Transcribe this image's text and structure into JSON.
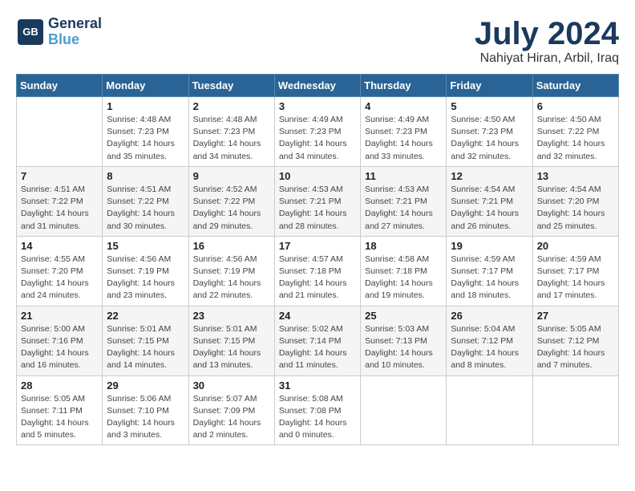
{
  "header": {
    "logo_line1": "General",
    "logo_line2": "Blue",
    "month_title": "July 2024",
    "location": "Nahiyat Hiran, Arbil, Iraq"
  },
  "days_of_week": [
    "Sunday",
    "Monday",
    "Tuesday",
    "Wednesday",
    "Thursday",
    "Friday",
    "Saturday"
  ],
  "weeks": [
    [
      {
        "num": "",
        "info": ""
      },
      {
        "num": "1",
        "info": "Sunrise: 4:48 AM\nSunset: 7:23 PM\nDaylight: 14 hours\nand 35 minutes."
      },
      {
        "num": "2",
        "info": "Sunrise: 4:48 AM\nSunset: 7:23 PM\nDaylight: 14 hours\nand 34 minutes."
      },
      {
        "num": "3",
        "info": "Sunrise: 4:49 AM\nSunset: 7:23 PM\nDaylight: 14 hours\nand 34 minutes."
      },
      {
        "num": "4",
        "info": "Sunrise: 4:49 AM\nSunset: 7:23 PM\nDaylight: 14 hours\nand 33 minutes."
      },
      {
        "num": "5",
        "info": "Sunrise: 4:50 AM\nSunset: 7:23 PM\nDaylight: 14 hours\nand 32 minutes."
      },
      {
        "num": "6",
        "info": "Sunrise: 4:50 AM\nSunset: 7:22 PM\nDaylight: 14 hours\nand 32 minutes."
      }
    ],
    [
      {
        "num": "7",
        "info": "Sunrise: 4:51 AM\nSunset: 7:22 PM\nDaylight: 14 hours\nand 31 minutes."
      },
      {
        "num": "8",
        "info": "Sunrise: 4:51 AM\nSunset: 7:22 PM\nDaylight: 14 hours\nand 30 minutes."
      },
      {
        "num": "9",
        "info": "Sunrise: 4:52 AM\nSunset: 7:22 PM\nDaylight: 14 hours\nand 29 minutes."
      },
      {
        "num": "10",
        "info": "Sunrise: 4:53 AM\nSunset: 7:21 PM\nDaylight: 14 hours\nand 28 minutes."
      },
      {
        "num": "11",
        "info": "Sunrise: 4:53 AM\nSunset: 7:21 PM\nDaylight: 14 hours\nand 27 minutes."
      },
      {
        "num": "12",
        "info": "Sunrise: 4:54 AM\nSunset: 7:21 PM\nDaylight: 14 hours\nand 26 minutes."
      },
      {
        "num": "13",
        "info": "Sunrise: 4:54 AM\nSunset: 7:20 PM\nDaylight: 14 hours\nand 25 minutes."
      }
    ],
    [
      {
        "num": "14",
        "info": "Sunrise: 4:55 AM\nSunset: 7:20 PM\nDaylight: 14 hours\nand 24 minutes."
      },
      {
        "num": "15",
        "info": "Sunrise: 4:56 AM\nSunset: 7:19 PM\nDaylight: 14 hours\nand 23 minutes."
      },
      {
        "num": "16",
        "info": "Sunrise: 4:56 AM\nSunset: 7:19 PM\nDaylight: 14 hours\nand 22 minutes."
      },
      {
        "num": "17",
        "info": "Sunrise: 4:57 AM\nSunset: 7:18 PM\nDaylight: 14 hours\nand 21 minutes."
      },
      {
        "num": "18",
        "info": "Sunrise: 4:58 AM\nSunset: 7:18 PM\nDaylight: 14 hours\nand 19 minutes."
      },
      {
        "num": "19",
        "info": "Sunrise: 4:59 AM\nSunset: 7:17 PM\nDaylight: 14 hours\nand 18 minutes."
      },
      {
        "num": "20",
        "info": "Sunrise: 4:59 AM\nSunset: 7:17 PM\nDaylight: 14 hours\nand 17 minutes."
      }
    ],
    [
      {
        "num": "21",
        "info": "Sunrise: 5:00 AM\nSunset: 7:16 PM\nDaylight: 14 hours\nand 16 minutes."
      },
      {
        "num": "22",
        "info": "Sunrise: 5:01 AM\nSunset: 7:15 PM\nDaylight: 14 hours\nand 14 minutes."
      },
      {
        "num": "23",
        "info": "Sunrise: 5:01 AM\nSunset: 7:15 PM\nDaylight: 14 hours\nand 13 minutes."
      },
      {
        "num": "24",
        "info": "Sunrise: 5:02 AM\nSunset: 7:14 PM\nDaylight: 14 hours\nand 11 minutes."
      },
      {
        "num": "25",
        "info": "Sunrise: 5:03 AM\nSunset: 7:13 PM\nDaylight: 14 hours\nand 10 minutes."
      },
      {
        "num": "26",
        "info": "Sunrise: 5:04 AM\nSunset: 7:12 PM\nDaylight: 14 hours\nand 8 minutes."
      },
      {
        "num": "27",
        "info": "Sunrise: 5:05 AM\nSunset: 7:12 PM\nDaylight: 14 hours\nand 7 minutes."
      }
    ],
    [
      {
        "num": "28",
        "info": "Sunrise: 5:05 AM\nSunset: 7:11 PM\nDaylight: 14 hours\nand 5 minutes."
      },
      {
        "num": "29",
        "info": "Sunrise: 5:06 AM\nSunset: 7:10 PM\nDaylight: 14 hours\nand 3 minutes."
      },
      {
        "num": "30",
        "info": "Sunrise: 5:07 AM\nSunset: 7:09 PM\nDaylight: 14 hours\nand 2 minutes."
      },
      {
        "num": "31",
        "info": "Sunrise: 5:08 AM\nSunset: 7:08 PM\nDaylight: 14 hours\nand 0 minutes."
      },
      {
        "num": "",
        "info": ""
      },
      {
        "num": "",
        "info": ""
      },
      {
        "num": "",
        "info": ""
      }
    ]
  ]
}
